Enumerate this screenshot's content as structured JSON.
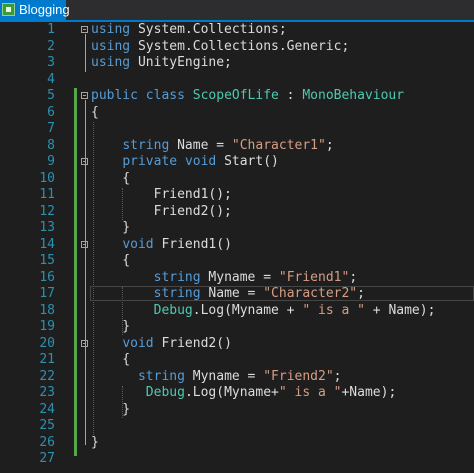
{
  "tab": {
    "title": "Blogging",
    "icon": "csharp-file-icon"
  },
  "colors": {
    "accent": "#007acc",
    "keyword": "#569cd6",
    "type": "#4ec9b0",
    "string": "#d69d85",
    "line_number": "#2b91af",
    "change_bar": "#57a64a"
  },
  "lines": [
    {
      "n": "1",
      "tokens": [
        [
          "kw",
          "using"
        ],
        [
          "p",
          " System.Collections;"
        ]
      ]
    },
    {
      "n": "2",
      "tokens": [
        [
          "kw",
          "using"
        ],
        [
          "p",
          " System.Collections.Generic;"
        ]
      ]
    },
    {
      "n": "3",
      "tokens": [
        [
          "kw",
          "using"
        ],
        [
          "p",
          " UnityEngine;"
        ]
      ]
    },
    {
      "n": "4",
      "tokens": []
    },
    {
      "n": "5",
      "tokens": [
        [
          "kw",
          "public"
        ],
        [
          "p",
          " "
        ],
        [
          "kw",
          "class"
        ],
        [
          "p",
          " "
        ],
        [
          "ty",
          "ScopeOfLife"
        ],
        [
          "p",
          " : "
        ],
        [
          "ty",
          "MonoBehaviour"
        ]
      ]
    },
    {
      "n": "6",
      "tokens": [
        [
          "p",
          "{"
        ]
      ]
    },
    {
      "n": "7",
      "tokens": []
    },
    {
      "n": "8",
      "tokens": [
        [
          "p",
          "    "
        ],
        [
          "kw",
          "string"
        ],
        [
          "p",
          " Name = "
        ],
        [
          "str",
          "\"Character1\""
        ],
        [
          "p",
          ";"
        ]
      ]
    },
    {
      "n": "9",
      "tokens": [
        [
          "p",
          "    "
        ],
        [
          "kw",
          "private"
        ],
        [
          "p",
          " "
        ],
        [
          "kw",
          "void"
        ],
        [
          "p",
          " Start()"
        ]
      ]
    },
    {
      "n": "10",
      "tokens": [
        [
          "p",
          "    {"
        ]
      ]
    },
    {
      "n": "11",
      "tokens": [
        [
          "p",
          "        Friend1();"
        ]
      ]
    },
    {
      "n": "12",
      "tokens": [
        [
          "p",
          "        Friend2();"
        ]
      ]
    },
    {
      "n": "13",
      "tokens": [
        [
          "p",
          "    }"
        ]
      ]
    },
    {
      "n": "14",
      "tokens": [
        [
          "p",
          "    "
        ],
        [
          "kw",
          "void"
        ],
        [
          "p",
          " Friend1()"
        ]
      ]
    },
    {
      "n": "15",
      "tokens": [
        [
          "p",
          "    {"
        ]
      ]
    },
    {
      "n": "16",
      "tokens": [
        [
          "p",
          "        "
        ],
        [
          "kw",
          "string"
        ],
        [
          "p",
          " Myname = "
        ],
        [
          "str",
          "\"Friend1\""
        ],
        [
          "p",
          ";"
        ]
      ]
    },
    {
      "n": "17",
      "tokens": [
        [
          "p",
          "        "
        ],
        [
          "kw",
          "string"
        ],
        [
          "p",
          " Name = "
        ],
        [
          "str",
          "\"Character2\""
        ],
        [
          "p",
          ";"
        ]
      ]
    },
    {
      "n": "18",
      "tokens": [
        [
          "p",
          "        "
        ],
        [
          "ty",
          "Debug"
        ],
        [
          "p",
          ".Log(Myname + "
        ],
        [
          "str",
          "\" is a \""
        ],
        [
          "p",
          " + Name);"
        ]
      ]
    },
    {
      "n": "19",
      "tokens": [
        [
          "p",
          "    }"
        ]
      ]
    },
    {
      "n": "20",
      "tokens": [
        [
          "p",
          "    "
        ],
        [
          "kw",
          "void"
        ],
        [
          "p",
          " Friend2()"
        ]
      ]
    },
    {
      "n": "21",
      "tokens": [
        [
          "p",
          "    {"
        ]
      ]
    },
    {
      "n": "22",
      "tokens": [
        [
          "p",
          "      "
        ],
        [
          "kw",
          "string"
        ],
        [
          "p",
          " Myname = "
        ],
        [
          "str",
          "\"Friend2\""
        ],
        [
          "p",
          ";"
        ]
      ]
    },
    {
      "n": "23",
      "tokens": [
        [
          "p",
          "       "
        ],
        [
          "ty",
          "Debug"
        ],
        [
          "p",
          ".Log(Myname+"
        ],
        [
          "str",
          "\" is a \""
        ],
        [
          "p",
          "+Name);"
        ]
      ]
    },
    {
      "n": "24",
      "tokens": [
        [
          "p",
          "    }"
        ]
      ]
    },
    {
      "n": "25",
      "tokens": []
    },
    {
      "n": "26",
      "tokens": [
        [
          "p",
          "}"
        ]
      ]
    },
    {
      "n": "27",
      "tokens": []
    }
  ]
}
